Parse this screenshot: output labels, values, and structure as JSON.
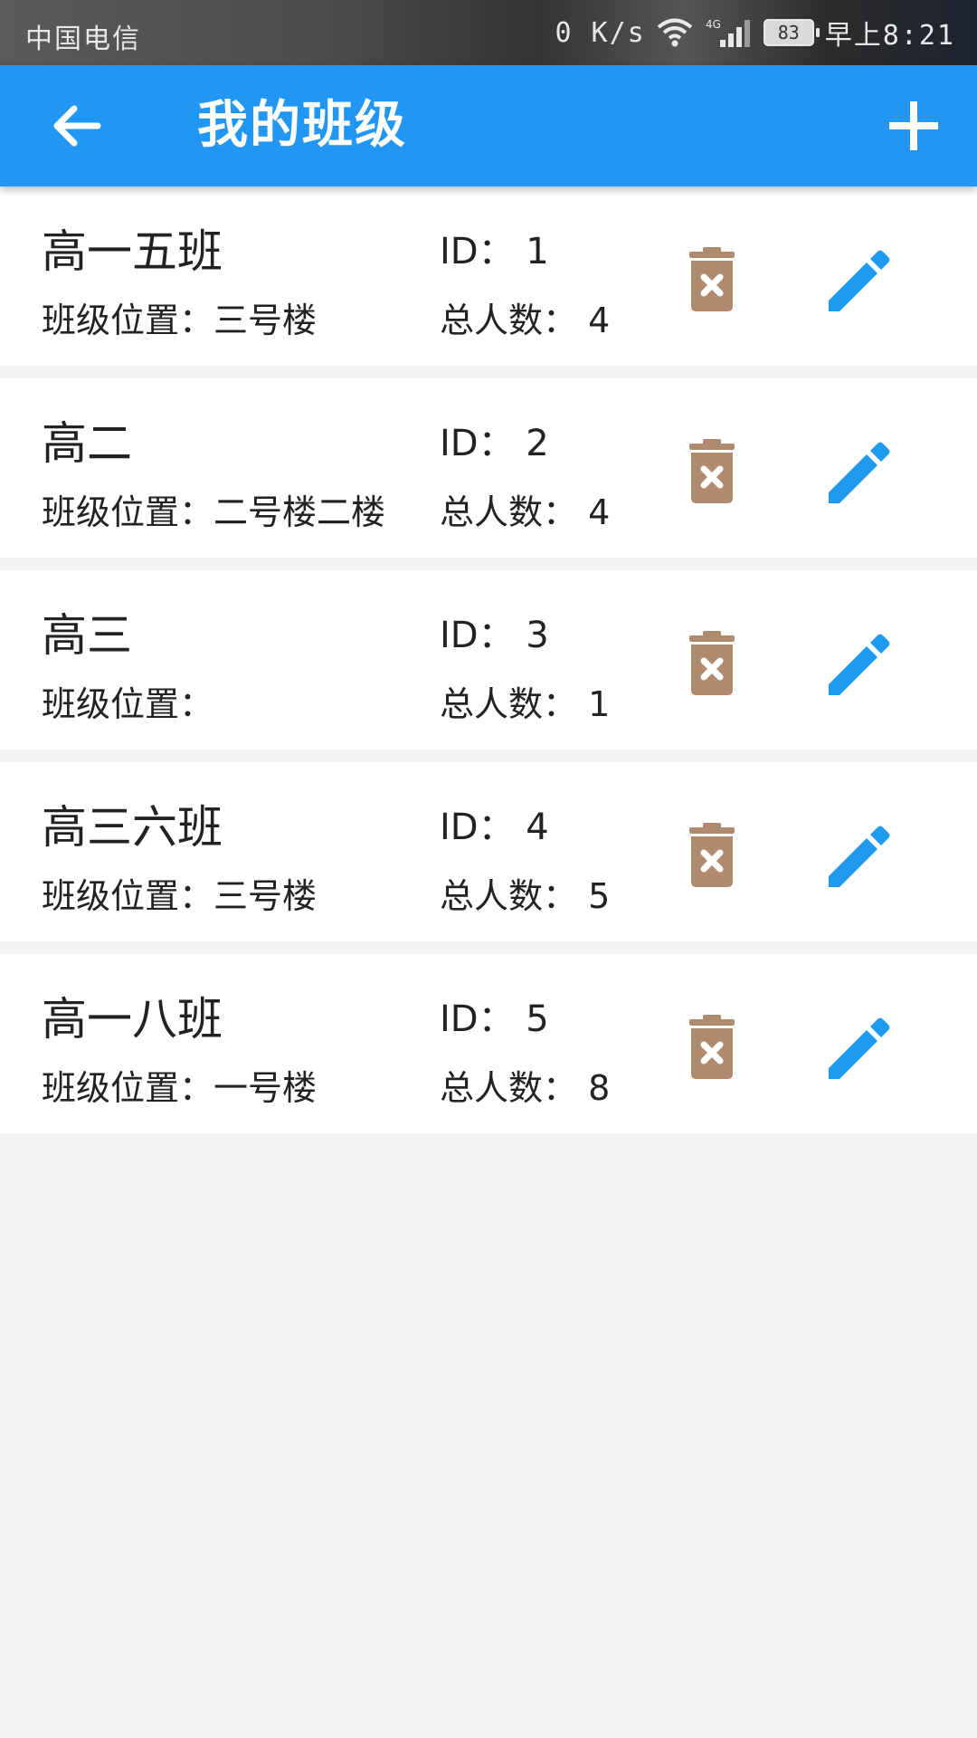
{
  "status_bar": {
    "carrier": "中国电信",
    "net_speed": "0 K/s",
    "network_type": "4G",
    "battery": "83",
    "time": "早上8:21"
  },
  "app_bar": {
    "title": "我的班级",
    "back_icon": "arrow-back-icon",
    "add_icon": "plus-icon",
    "color": "#2196F3"
  },
  "labels": {
    "id_prefix": "ID：",
    "location_prefix": "班级位置：",
    "count_prefix": "总人数："
  },
  "colors": {
    "delete_icon": "#B08A6E",
    "edit_icon": "#1E9BEF"
  },
  "classes": [
    {
      "name": "高一五班",
      "id": "1",
      "location": "三号楼",
      "count": "4"
    },
    {
      "name": "高二",
      "id": "2",
      "location": "二号楼二楼",
      "count": "4"
    },
    {
      "name": "高三",
      "id": "3",
      "location": "",
      "count": "1"
    },
    {
      "name": "高三六班",
      "id": "4",
      "location": "三号楼",
      "count": "5"
    },
    {
      "name": "高一八班",
      "id": "5",
      "location": "一号楼",
      "count": "8"
    }
  ]
}
